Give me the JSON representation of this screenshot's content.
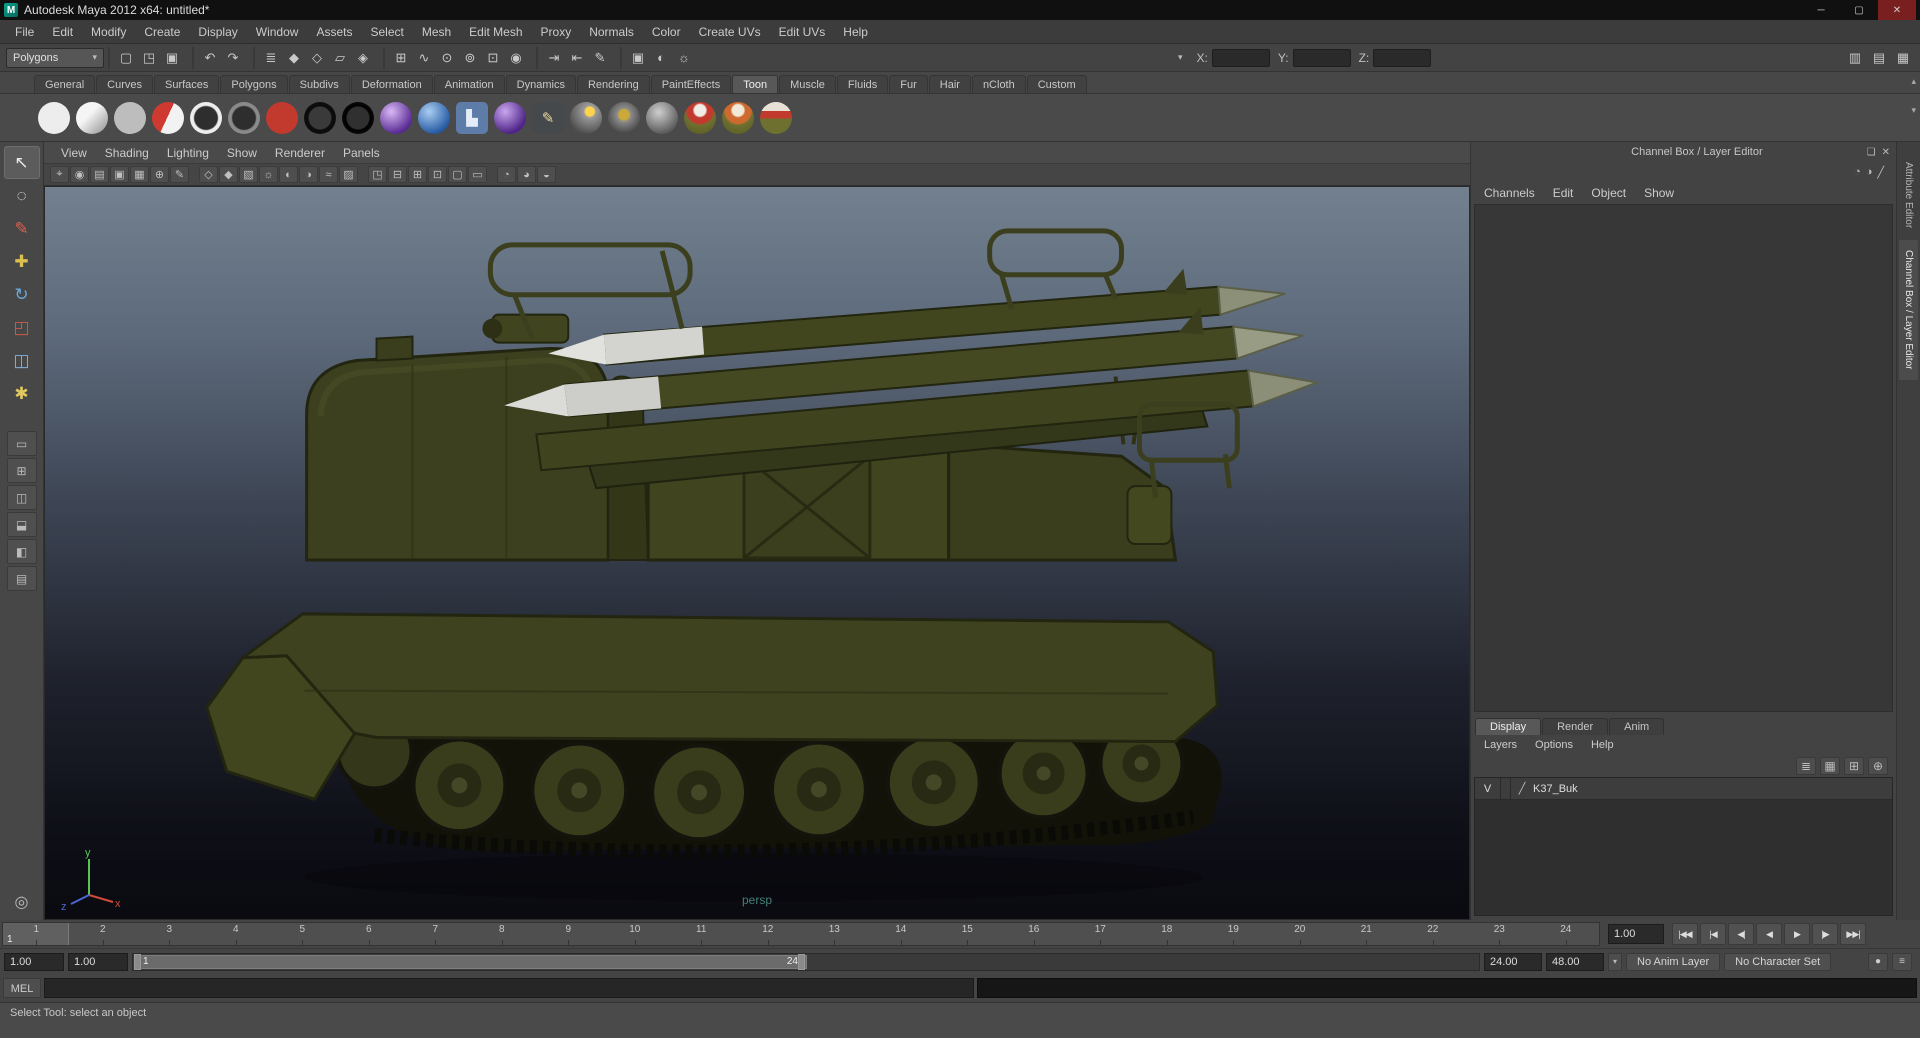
{
  "title_bar": {
    "icon": "M",
    "title": "Autodesk Maya 2012 x64: untitled*",
    "controls": [
      {
        "name": "minimize-button",
        "glyph": "─"
      },
      {
        "name": "maximize-button",
        "glyph": "▢"
      },
      {
        "name": "close-button",
        "glyph": "✕"
      }
    ]
  },
  "menu_bar": {
    "items": [
      "File",
      "Edit",
      "Modify",
      "Create",
      "Display",
      "Window",
      "Assets",
      "Select",
      "Mesh",
      "Edit Mesh",
      "Proxy",
      "Normals",
      "Color",
      "Create UVs",
      "Edit UVs",
      "Help"
    ]
  },
  "status_line": {
    "menu_set_value": "Polygons",
    "dropdown_arrow": "▾",
    "icon_groups": [
      {
        "name": "file-group",
        "icons": [
          {
            "name": "new-scene-icon",
            "glyph": "▢"
          },
          {
            "name": "open-scene-icon",
            "glyph": "◳"
          },
          {
            "name": "save-scene-icon",
            "glyph": "▣"
          }
        ]
      },
      {
        "name": "undo-group",
        "icons": [
          {
            "name": "undo-icon",
            "glyph": "↶"
          },
          {
            "name": "redo-icon",
            "glyph": "↷"
          }
        ]
      },
      {
        "name": "selection-mode-group",
        "icons": [
          {
            "name": "select-hierarchy-icon",
            "glyph": "≣"
          },
          {
            "name": "select-object-icon",
            "glyph": "◆"
          },
          {
            "name": "select-component-icon",
            "glyph": "◇"
          },
          {
            "name": "select-asset-icon",
            "glyph": "▱"
          },
          {
            "name": "highlight-selection-icon",
            "glyph": "◈"
          }
        ]
      },
      {
        "name": "snap-group",
        "icons": [
          {
            "name": "snap-grid-icon",
            "glyph": "⊞"
          },
          {
            "name": "snap-curve-icon",
            "glyph": "∿"
          },
          {
            "name": "snap-point-icon",
            "glyph": "⊙"
          },
          {
            "name": "snap-projected-center-icon",
            "glyph": "⊚"
          },
          {
            "name": "snap-view-plane-icon",
            "glyph": "⊡"
          },
          {
            "name": "make-live-icon",
            "glyph": "◉"
          }
        ]
      },
      {
        "name": "history-group",
        "icons": [
          {
            "name": "input-operations-icon",
            "glyph": "⇥"
          },
          {
            "name": "output-operations-icon",
            "glyph": "⇤"
          },
          {
            "name": "construction-history-icon",
            "glyph": "✎"
          }
        ]
      },
      {
        "name": "render-group",
        "icons": [
          {
            "name": "render-current-frame-icon",
            "glyph": "▣"
          },
          {
            "name": "ipr-render-icon",
            "glyph": "◐"
          },
          {
            "name": "render-settings-icon",
            "glyph": "☼"
          }
        ]
      }
    ],
    "coord_dropdown_arrow": "▾",
    "coord_fields": [
      {
        "label": "X:",
        "value": ""
      },
      {
        "label": "Y:",
        "value": ""
      },
      {
        "label": "Z:",
        "value": ""
      }
    ],
    "right_icons": [
      {
        "name": "show-channel-box-icon",
        "glyph": "▥"
      },
      {
        "name": "show-layer-editor-icon",
        "glyph": "▤"
      },
      {
        "name": "show-channel-layer-icon",
        "glyph": "▦"
      }
    ]
  },
  "shelf": {
    "corner_icons": [
      {
        "name": "shelf-tabs-toggle-icon",
        "glyph": "▾"
      },
      {
        "name": "shelf-collapse-icon",
        "glyph": "▴"
      }
    ],
    "right_icons": [
      {
        "name": "shelf-hide-icon",
        "glyph": "▴"
      },
      {
        "name": "shelf-menu-icon",
        "glyph": "▾"
      }
    ],
    "tabs": [
      {
        "label": "General",
        "active": false
      },
      {
        "label": "Curves",
        "active": false
      },
      {
        "label": "Surfaces",
        "active": false
      },
      {
        "label": "Polygons",
        "active": false
      },
      {
        "label": "Subdivs",
        "active": false
      },
      {
        "label": "Deformation",
        "active": false
      },
      {
        "label": "Animation",
        "active": false
      },
      {
        "label": "Dynamics",
        "active": false
      },
      {
        "label": "Rendering",
        "active": false
      },
      {
        "label": "PaintEffects",
        "active": false
      },
      {
        "label": "Toon",
        "active": true
      },
      {
        "label": "Muscle",
        "active": false
      },
      {
        "label": "Fluids",
        "active": false
      },
      {
        "label": "Fur",
        "active": false
      },
      {
        "label": "Hair",
        "active": false
      },
      {
        "label": "nCloth",
        "active": false
      },
      {
        "label": "Custom",
        "active": false
      }
    ],
    "items": [
      {
        "name": "toon-fill-solid-white-icon",
        "bg": "#ededed"
      },
      {
        "name": "toon-fill-light-gradient-icon",
        "bg": "linear-gradient(135deg,#f5f5f5 40%,#8d8d8d 100%)"
      },
      {
        "name": "toon-fill-gray-icon",
        "bg": "#bdbdbd"
      },
      {
        "name": "toon-fill-two-tone-icon",
        "bg": "linear-gradient(115deg,#cf3a30 48%,#f2f2f2 48%)"
      },
      {
        "name": "toon-outline-white-icon",
        "bg": "radial-gradient(circle,#2e2e2e 50%,#ededed 56%)"
      },
      {
        "name": "toon-outline-gray-icon",
        "bg": "radial-gradient(circle,#2e2e2e 50%,#8a8a8a 56%)"
      },
      {
        "name": "toon-fill-red-icon",
        "bg": "#c23a2e"
      },
      {
        "name": "toon-outline-black-icon",
        "bg": "radial-gradient(circle,#3a3a3a 48%,#0a0a0a 54%,#151515 100%)"
      },
      {
        "name": "toon-outline-dark-icon",
        "bg": "radial-gradient(circle,#303030 48%,#000000 54%,#181818 100%)"
      },
      {
        "name": "toon-paintfx-purple-icon",
        "bg": "radial-gradient(circle at 35% 30%,#d9b8f5,#5d2f96 70%,#3a1c63)"
      },
      {
        "name": "toon-paintfx-blue-icon",
        "bg": "radial-gradient(circle at 35% 30%,#aacdf2,#2a5ea6 70%,#173a6e)"
      },
      {
        "name": "toon-profile-chart-icon",
        "bg": "#5d7ca8",
        "radius": "5px",
        "glyph": "▙",
        "glyph_color": "#e3ecf7"
      },
      {
        "name": "toon-paintfx-violet-icon",
        "bg": "radial-gradient(circle at 35% 30%,#c9a6ee,#4f2688 70%)"
      },
      {
        "name": "toon-brush-icon",
        "bg": "#45494b",
        "radius": "5px",
        "glyph": "✎",
        "glyph_color": "#e8d8a0"
      },
      {
        "name": "toon-ball-yellow-dot-icon",
        "bg": "radial-gradient(circle at 62% 30%,#ffd34d 15%,#9a9a9a 20%,#4f4f4f 75%)"
      },
      {
        "name": "toon-ball-yellow-ring-icon",
        "bg": "radial-gradient(circle at 50% 40%,#caa93a 20%,#8a8a8a 28%,#474747 75%)"
      },
      {
        "name": "toon-ball-gray-icon",
        "bg": "radial-gradient(circle at 40% 32%,#cfcfcf,#5a5a5a 75%)"
      },
      {
        "name": "toon-example-red-cap-ball-icon",
        "bg": "radial-gradient(circle at 50% 26%,#f0ede6 20%,#c23a2e 26%,#c23a2e 46%,#6e7030 52%,#565822)"
      },
      {
        "name": "toon-example-orange-cap-ball-icon",
        "bg": "radial-gradient(circle at 50% 26%,#f2e9d8 20%,#cf6a2e 26%,#cf6a2e 46%,#6e7030 52%,#565822)"
      },
      {
        "name": "toon-example-stripe-ball-icon",
        "bg": "linear-gradient(180deg,#e8e2d6 28%,#c23a2e 28%,#c23a2e 52%,#6e7030 52%)"
      }
    ]
  },
  "toolbox": {
    "tools": [
      {
        "name": "select-tool",
        "glyph": "↖",
        "color": "#e8e8e8",
        "active": true
      },
      {
        "name": "lasso-select-tool",
        "glyph": "◌",
        "color": "#e0e0e0",
        "active": false
      },
      {
        "name": "paint-select-tool",
        "glyph": "✎",
        "color": "#d9604f",
        "active": false
      },
      {
        "name": "move-tool",
        "glyph": "✚",
        "color": "#d9c04f",
        "active": false
      },
      {
        "name": "rotate-tool",
        "glyph": "↻",
        "color": "#6fa8dc",
        "active": false
      },
      {
        "name": "scale-tool",
        "glyph": "◰",
        "color": "#cf5a4a",
        "active": false
      },
      {
        "name": "universal-manipulator-tool",
        "glyph": "◫",
        "color": "#7fb2e0",
        "active": false
      },
      {
        "name": "soft-modification-tool",
        "glyph": "✱",
        "color": "#e0c860",
        "active": false
      }
    ],
    "layouts": [
      {
        "name": "layout-single-pane-button",
        "glyph": "▭"
      },
      {
        "name": "layout-four-pane-button",
        "glyph": "⊞"
      },
      {
        "name": "layout-two-pane-side-button",
        "glyph": "◫"
      },
      {
        "name": "layout-two-pane-stacked-button",
        "glyph": "⬓"
      },
      {
        "name": "layout-persp-outliner-button",
        "glyph": "◧"
      },
      {
        "name": "layout-persp-graph-button",
        "glyph": "▤"
      }
    ],
    "bottom_icon": {
      "name": "hypershade-spheres-icon",
      "glyph": "◎"
    }
  },
  "viewport": {
    "menus": [
      "View",
      "Shading",
      "Lighting",
      "Show",
      "Renderer",
      "Panels"
    ],
    "toolbar_groups": [
      {
        "name": "camera-group",
        "icons": [
          {
            "name": "select-camera-icon",
            "glyph": "⌖"
          },
          {
            "name": "lock-camera-icon",
            "glyph": "◉"
          },
          {
            "name": "camera-attributes-icon",
            "glyph": "▤"
          },
          {
            "name": "bookmark-icon",
            "glyph": "▣"
          },
          {
            "name": "image-plane-icon",
            "glyph": "▦"
          },
          {
            "name": "2d-pan-zoom-icon",
            "glyph": "⊕"
          },
          {
            "name": "grease-pencil-icon",
            "glyph": "✎"
          }
        ]
      },
      {
        "name": "shading-group",
        "icons": [
          {
            "name": "wireframe-icon",
            "glyph": "◇"
          },
          {
            "name": "shaded-icon",
            "glyph": "◆"
          },
          {
            "name": "textured-icon",
            "glyph": "▧"
          },
          {
            "name": "use-all-lights-icon",
            "glyph": "☼"
          },
          {
            "name": "shadows-icon",
            "glyph": "◐"
          },
          {
            "name": "screen-space-ao-icon",
            "glyph": "◑"
          },
          {
            "name": "motion-blur-icon",
            "glyph": "≈"
          },
          {
            "name": "multisampling-icon",
            "glyph": "▨"
          }
        ]
      },
      {
        "name": "gate-group",
        "icons": [
          {
            "name": "isolate-select-icon",
            "glyph": "◳"
          },
          {
            "name": "field-chart-icon",
            "glyph": "⊟"
          },
          {
            "name": "resolution-gate-icon",
            "glyph": "⊞"
          },
          {
            "name": "gate-mask-icon",
            "glyph": "⊡"
          },
          {
            "name": "safe-action-icon",
            "glyph": "▢"
          },
          {
            "name": "safe-title-icon",
            "glyph": "▭"
          }
        ]
      },
      {
        "name": "display-group",
        "icons": [
          {
            "name": "xray-icon",
            "glyph": "◔"
          },
          {
            "name": "xray-joints-icon",
            "glyph": "◕"
          },
          {
            "name": "exposure-icon",
            "glyph": "◒"
          }
        ]
      }
    ],
    "camera_label": "persp",
    "axis_labels": {
      "x": "x",
      "y": "y",
      "z": "z"
    }
  },
  "channel_box": {
    "header_title": "Channel Box / Layer Editor",
    "header_controls": [
      {
        "name": "dock-panel-icon",
        "glyph": "❏"
      },
      {
        "name": "close-panel-icon",
        "glyph": "✕"
      }
    ],
    "toolbar_icons": [
      {
        "name": "slow-manipulation-icon",
        "glyph": "◔"
      },
      {
        "name": "medium-manipulation-icon",
        "glyph": "◑"
      },
      {
        "name": "hyperbolic-manipulation-icon",
        "glyph": "╱"
      }
    ],
    "menus": [
      "Channels",
      "Edit",
      "Object",
      "Show"
    ],
    "side_tabs": [
      {
        "label": "Attribute Editor",
        "active": false
      },
      {
        "label": "Channel Box / Layer Editor",
        "active": true
      }
    ]
  },
  "layer_editor": {
    "tabs": [
      {
        "label": "Display",
        "active": true
      },
      {
        "label": "Render",
        "active": false
      },
      {
        "label": "Anim",
        "active": false
      }
    ],
    "menus": [
      "Layers",
      "Options",
      "Help"
    ],
    "toolbar_icons": [
      {
        "name": "layers-sort-icon",
        "glyph": "≣"
      },
      {
        "name": "create-empty-layer-icon",
        "glyph": "▦"
      },
      {
        "name": "create-layer-assign-selected-icon",
        "glyph": "⊞"
      },
      {
        "name": "create-layer-icon",
        "glyph": "⊕"
      }
    ],
    "layers": [
      {
        "visibility": "V",
        "type_glyph": "╱",
        "name": "K37_Buk"
      }
    ]
  },
  "time_slider": {
    "ticks": [
      "1",
      "2",
      "3",
      "4",
      "5",
      "6",
      "7",
      "8",
      "9",
      "10",
      "11",
      "12",
      "13",
      "14",
      "15",
      "16",
      "17",
      "18",
      "19",
      "20",
      "21",
      "22",
      "23",
      "24"
    ],
    "current_frame": "1",
    "current_time": "1.00",
    "playback_buttons": [
      {
        "name": "go-to-start-button",
        "glyph": "|◀◀"
      },
      {
        "name": "step-back-key-button",
        "glyph": "|◀"
      },
      {
        "name": "step-back-frame-button",
        "glyph": "◀|"
      },
      {
        "name": "play-backward-button",
        "glyph": "◀"
      },
      {
        "name": "play-forward-button",
        "glyph": "▶"
      },
      {
        "name": "step-forward-frame-button",
        "glyph": "|▶"
      },
      {
        "name": "go-to-end-button",
        "glyph": "▶▶|"
      }
    ]
  },
  "range_slider": {
    "animation_start": "1.00",
    "playback_start": "1.00",
    "range_start_label": "1",
    "range_end_label": "24",
    "playback_end": "24.00",
    "animation_end": "48.00",
    "dropdown_arrow": "▾",
    "anim_layer_button": "No Anim Layer",
    "character_set_button": "No Character Set",
    "right_icons": [
      {
        "name": "auto-keyframe-icon",
        "glyph": "●"
      },
      {
        "name": "animation-preferences-icon",
        "glyph": "≡"
      }
    ]
  },
  "command_line": {
    "label": "MEL",
    "input_value": "",
    "result_value": ""
  },
  "help_line": {
    "text": "Select Tool: select an object"
  }
}
